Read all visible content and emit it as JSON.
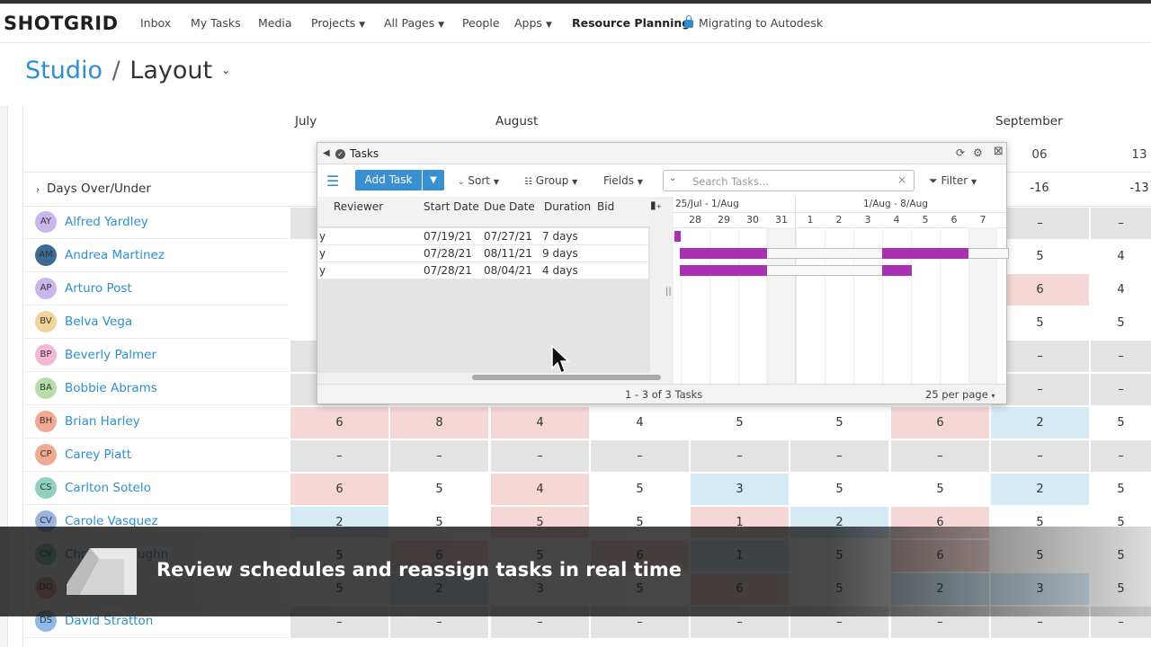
{
  "brand": "SHOTGRID",
  "nav": [
    {
      "label": "Inbox",
      "caret": false
    },
    {
      "label": "My Tasks",
      "caret": false
    },
    {
      "label": "Media",
      "caret": false
    },
    {
      "label": "Projects",
      "caret": true
    },
    {
      "label": "All Pages",
      "caret": true
    },
    {
      "label": "People",
      "caret": false
    },
    {
      "label": "Apps",
      "caret": true
    },
    {
      "label": "Resource Planning",
      "caret": false
    },
    {
      "label": "Migrating to Autodesk",
      "caret": false
    }
  ],
  "breadcrumb": {
    "root": "Studio",
    "sep": "/",
    "page": "Layout"
  },
  "months": [
    "July",
    "August",
    "September"
  ],
  "weeks": [
    "06",
    "13"
  ],
  "days_over_under": {
    "label": "Days Over/Under",
    "values": [
      "-16",
      "-13"
    ]
  },
  "people": [
    {
      "initials": "AY",
      "name": "Alfred Yardley",
      "color": "#c9b6ec"
    },
    {
      "initials": "AM",
      "name": "Andrea Martinez",
      "color": "#3c6b94"
    },
    {
      "initials": "AP",
      "name": "Arturo Post",
      "color": "#c9b6ec"
    },
    {
      "initials": "BV",
      "name": "Belva Vega",
      "color": "#f1d49a"
    },
    {
      "initials": "BP",
      "name": "Beverly Palmer",
      "color": "#f3b8d5"
    },
    {
      "initials": "BA",
      "name": "Bobbie Abrams",
      "color": "#b7dca8"
    },
    {
      "initials": "BH",
      "name": "Brian Harley",
      "color": "#f1a994"
    },
    {
      "initials": "CP",
      "name": "Carey Piatt",
      "color": "#f1a994"
    },
    {
      "initials": "CS",
      "name": "Carlton Sotelo",
      "color": "#8fd1c1"
    },
    {
      "initials": "CV",
      "name": "Carole Vasquez",
      "color": "#9ab6e0"
    },
    {
      "initials": "CV",
      "name": "Christine Vaughn",
      "color": "#8fd1c1"
    },
    {
      "initials": "DO",
      "name": "David Ortiz",
      "color": "#f1a994"
    },
    {
      "initials": "DS",
      "name": "David Stratton",
      "color": "#8fb8e8"
    }
  ],
  "grid_rows": [
    [
      {
        "v": "–",
        "c": "g"
      },
      null,
      null,
      null,
      null,
      null,
      null,
      {
        "v": "–",
        "c": "g"
      },
      {
        "v": "–",
        "c": "g"
      }
    ],
    [
      null,
      null,
      null,
      null,
      null,
      null,
      null,
      {
        "v": "5",
        "c": "w"
      },
      {
        "v": "4",
        "c": "w"
      }
    ],
    [
      null,
      null,
      null,
      null,
      null,
      null,
      null,
      {
        "v": "6",
        "c": "r"
      },
      {
        "v": "4",
        "c": "w"
      }
    ],
    [
      null,
      null,
      null,
      null,
      null,
      null,
      null,
      {
        "v": "5",
        "c": "w"
      },
      {
        "v": "5",
        "c": "w"
      }
    ],
    [
      {
        "v": "",
        "c": "g"
      },
      null,
      null,
      null,
      null,
      null,
      null,
      {
        "v": "–",
        "c": "g"
      },
      {
        "v": "–",
        "c": "g"
      }
    ],
    [
      {
        "v": "",
        "c": "g"
      },
      null,
      null,
      null,
      null,
      null,
      null,
      {
        "v": "–",
        "c": "g"
      },
      {
        "v": "–",
        "c": "g"
      }
    ],
    [
      {
        "v": "6",
        "c": "r"
      },
      {
        "v": "8",
        "c": "r"
      },
      {
        "v": "4",
        "c": "r"
      },
      {
        "v": "4",
        "c": "w"
      },
      {
        "v": "5",
        "c": "w"
      },
      {
        "v": "5",
        "c": "w"
      },
      {
        "v": "6",
        "c": "r"
      },
      {
        "v": "2",
        "c": "b"
      },
      {
        "v": "5",
        "c": "w"
      }
    ],
    [
      {
        "v": "–",
        "c": "g"
      },
      {
        "v": "–",
        "c": "g"
      },
      {
        "v": "–",
        "c": "g"
      },
      {
        "v": "–",
        "c": "g"
      },
      {
        "v": "–",
        "c": "g"
      },
      {
        "v": "–",
        "c": "g"
      },
      {
        "v": "–",
        "c": "g"
      },
      {
        "v": "–",
        "c": "g"
      },
      {
        "v": "–",
        "c": "g"
      }
    ],
    [
      {
        "v": "6",
        "c": "r"
      },
      {
        "v": "5",
        "c": "w"
      },
      {
        "v": "4",
        "c": "r"
      },
      {
        "v": "5",
        "c": "w"
      },
      {
        "v": "3",
        "c": "b"
      },
      {
        "v": "5",
        "c": "w"
      },
      {
        "v": "5",
        "c": "w"
      },
      {
        "v": "2",
        "c": "b"
      },
      {
        "v": "5",
        "c": "w"
      }
    ],
    [
      {
        "v": "2",
        "c": "b"
      },
      {
        "v": "5",
        "c": "w"
      },
      {
        "v": "5",
        "c": "r"
      },
      {
        "v": "5",
        "c": "w"
      },
      {
        "v": "1",
        "c": "r"
      },
      {
        "v": "2",
        "c": "b"
      },
      {
        "v": "6",
        "c": "r"
      },
      {
        "v": "5",
        "c": "w"
      },
      {
        "v": "5",
        "c": "w"
      }
    ],
    [
      {
        "v": "5",
        "c": "w"
      },
      {
        "v": "6",
        "c": "r"
      },
      {
        "v": "5",
        "c": "w"
      },
      {
        "v": "6",
        "c": "r"
      },
      {
        "v": "1",
        "c": "b"
      },
      {
        "v": "5",
        "c": "w"
      },
      {
        "v": "6",
        "c": "r"
      },
      {
        "v": "5",
        "c": "w"
      },
      {
        "v": "5",
        "c": "w"
      }
    ],
    [
      {
        "v": "5",
        "c": "w"
      },
      {
        "v": "2",
        "c": "b"
      },
      {
        "v": "3",
        "c": "w"
      },
      {
        "v": "5",
        "c": "w"
      },
      {
        "v": "6",
        "c": "r"
      },
      {
        "v": "5",
        "c": "w"
      },
      {
        "v": "2",
        "c": "b"
      },
      {
        "v": "3",
        "c": "b"
      },
      {
        "v": "5",
        "c": "w"
      }
    ],
    [
      {
        "v": "–",
        "c": "g"
      },
      {
        "v": "–",
        "c": "g"
      },
      {
        "v": "–",
        "c": "g"
      },
      {
        "v": "–",
        "c": "g"
      },
      {
        "v": "–",
        "c": "g"
      },
      {
        "v": "–",
        "c": "g"
      },
      {
        "v": "–",
        "c": "g"
      },
      {
        "v": "–",
        "c": "g"
      },
      {
        "v": "–",
        "c": "g"
      }
    ]
  ],
  "tasks_dialog": {
    "title": "Tasks",
    "add_task": "Add Task",
    "sort": "Sort",
    "group": "Group",
    "fields": "Fields",
    "search_placeholder": "Search Tasks...",
    "filter": "Filter",
    "columns": [
      "Reviewer",
      "Start Date",
      "Due Date",
      "Duration",
      "Bid"
    ],
    "rows": [
      {
        "reviewer": "y",
        "start": "07/19/21",
        "due": "07/27/21",
        "duration": "7 days",
        "bid": ""
      },
      {
        "reviewer": "y",
        "start": "07/28/21",
        "due": "08/11/21",
        "duration": "9 days",
        "bid": ""
      },
      {
        "reviewer": "y",
        "start": "07/28/21",
        "due": "08/04/21",
        "duration": "4 days",
        "bid": ""
      }
    ],
    "gantt_weeks": [
      "25/Jul - 1/Aug",
      "1/Aug - 8/Aug"
    ],
    "gantt_days": [
      "28",
      "29",
      "30",
      "31",
      "1",
      "2",
      "3",
      "4",
      "5",
      "6",
      "7"
    ],
    "count": "1 - 3 of 3 Tasks",
    "per_page": "25 per page"
  },
  "banner": "Review schedules and reassign tasks in real time"
}
